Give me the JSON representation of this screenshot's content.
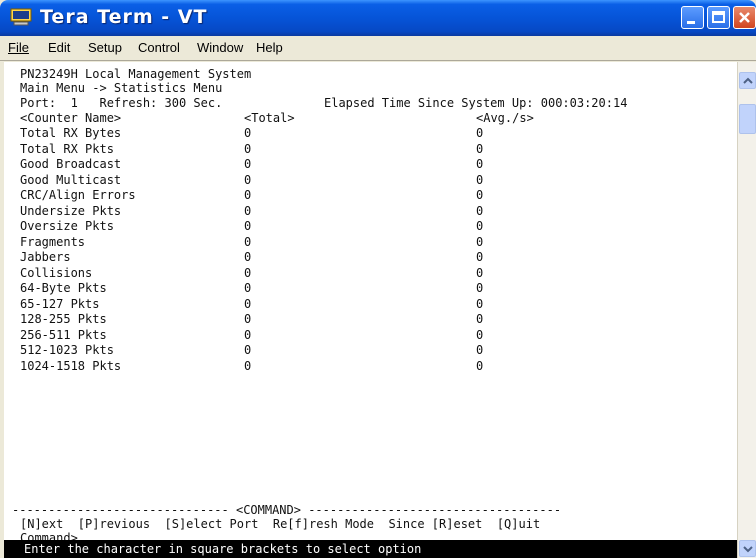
{
  "window": {
    "title": "Tera Term - VT"
  },
  "menu": {
    "items": [
      "File",
      "Edit",
      "Setup",
      "Control",
      "Window",
      "Help"
    ]
  },
  "terminal": {
    "header_line1": "PN23249H Local Management System",
    "header_line2": "Main Menu -> Statistics Menu",
    "port_line": "Port:  1   Refresh: 300 Sec.",
    "elapsed": "Elapsed Time Since System Up: 000:03:20:14",
    "columns": {
      "name": "<Counter Name>",
      "total": "<Total>",
      "avg": "<Avg./s>"
    },
    "counters": [
      {
        "name": "Total RX Bytes",
        "total": "0",
        "avg": "0"
      },
      {
        "name": "Total RX Pkts",
        "total": "0",
        "avg": "0"
      },
      {
        "name": "Good Broadcast",
        "total": "0",
        "avg": "0"
      },
      {
        "name": "Good Multicast",
        "total": "0",
        "avg": "0"
      },
      {
        "name": "CRC/Align Errors",
        "total": "0",
        "avg": "0"
      },
      {
        "name": "Undersize Pkts",
        "total": "0",
        "avg": "0"
      },
      {
        "name": "Oversize Pkts",
        "total": "0",
        "avg": "0"
      },
      {
        "name": "Fragments",
        "total": "0",
        "avg": "0"
      },
      {
        "name": "Jabbers",
        "total": "0",
        "avg": "0"
      },
      {
        "name": "Collisions",
        "total": "0",
        "avg": "0"
      },
      {
        "name": "64-Byte Pkts",
        "total": "0",
        "avg": "0"
      },
      {
        "name": "65-127 Pkts",
        "total": "0",
        "avg": "0"
      },
      {
        "name": "128-255 Pkts",
        "total": "0",
        "avg": "0"
      },
      {
        "name": "256-511 Pkts",
        "total": "0",
        "avg": "0"
      },
      {
        "name": "512-1023 Pkts",
        "total": "0",
        "avg": "0"
      },
      {
        "name": "1024-1518 Pkts",
        "total": "0",
        "avg": "0"
      }
    ],
    "command_divider": "------------------------------ <COMMAND> -----------------------------------",
    "commands": "[N]ext  [P]revious  [S]elect Port  Re[f]resh Mode  Since [R]eset  [Q]uit",
    "prompt": "Command>",
    "status": "Enter the character in square brackets to select option"
  }
}
